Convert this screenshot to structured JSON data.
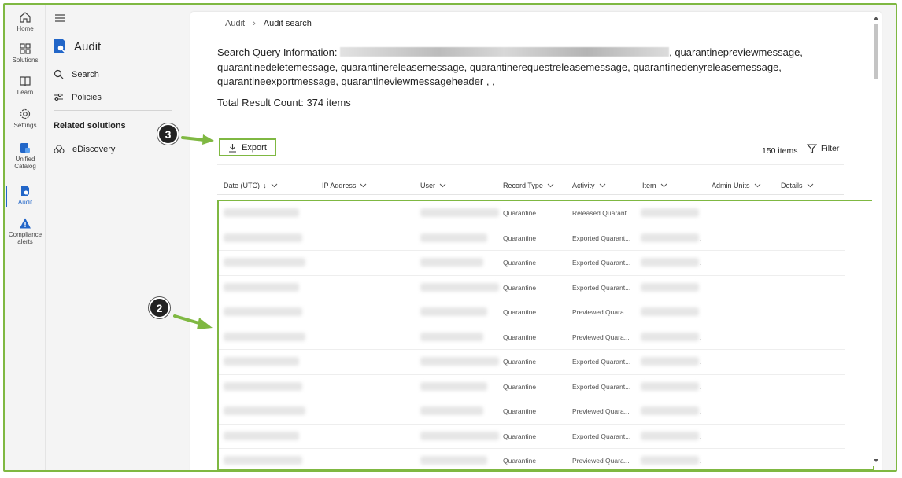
{
  "rail": {
    "items": [
      {
        "label": "Home",
        "icon": "home-icon"
      },
      {
        "label": "Solutions",
        "icon": "solutions-icon"
      },
      {
        "label": "Learn",
        "icon": "book-icon"
      },
      {
        "label": "Settings",
        "icon": "gear-icon"
      },
      {
        "label": "Unified Catalog",
        "icon": "catalog-icon"
      },
      {
        "label": "Audit",
        "icon": "audit-icon"
      },
      {
        "label": "Compliance alerts",
        "icon": "warning-icon"
      }
    ]
  },
  "nav": {
    "title": "Audit",
    "items": [
      {
        "label": "Search",
        "icon": "search-icon"
      },
      {
        "label": "Policies",
        "icon": "sliders-icon"
      }
    ],
    "related_heading": "Related solutions",
    "related_items": [
      {
        "label": "eDiscovery",
        "icon": "ediscovery-icon"
      }
    ]
  },
  "breadcrumb": {
    "parent": "Audit",
    "current": "Audit search"
  },
  "query": {
    "label": "Search Query Information:",
    "suffix": ", quarantinepreviewmessage, quarantinedeletemessage, quarantinereleasemessage, quarantinerequestreleasemessage, quarantinedenyreleasemessage, quarantineexportmessage, quarantineviewmessageheader , ,"
  },
  "total_result": "Total Result Count: 374 items",
  "toolbar": {
    "export_label": "Export",
    "items_count": "150 items",
    "filter_label": "Filter"
  },
  "table": {
    "columns": [
      "Date (UTC)",
      "IP Address",
      "User",
      "Record Type",
      "Activity",
      "Item",
      "Admin Units",
      "Details"
    ],
    "rows": [
      {
        "record_type": "Quarantine",
        "activity": "Released Quarant...",
        "item_dot": "."
      },
      {
        "record_type": "Quarantine",
        "activity": "Exported Quarant...",
        "item_dot": "."
      },
      {
        "record_type": "Quarantine",
        "activity": "Exported Quarant...",
        "item_dot": "."
      },
      {
        "record_type": "Quarantine",
        "activity": "Exported Quarant...",
        "item_dot": ""
      },
      {
        "record_type": "Quarantine",
        "activity": "Previewed Quara...",
        "item_dot": "."
      },
      {
        "record_type": "Quarantine",
        "activity": "Previewed Quara...",
        "item_dot": "."
      },
      {
        "record_type": "Quarantine",
        "activity": "Exported Quarant...",
        "item_dot": "."
      },
      {
        "record_type": "Quarantine",
        "activity": "Exported Quarant...",
        "item_dot": "."
      },
      {
        "record_type": "Quarantine",
        "activity": "Previewed Quara...",
        "item_dot": "."
      },
      {
        "record_type": "Quarantine",
        "activity": "Exported Quarant...",
        "item_dot": "."
      },
      {
        "record_type": "Quarantine",
        "activity": "Previewed Quara...",
        "item_dot": "."
      }
    ]
  },
  "callouts": {
    "step3": "3",
    "step2": "2"
  },
  "colors": {
    "highlight": "#7fb842",
    "accent": "#2266c8"
  }
}
